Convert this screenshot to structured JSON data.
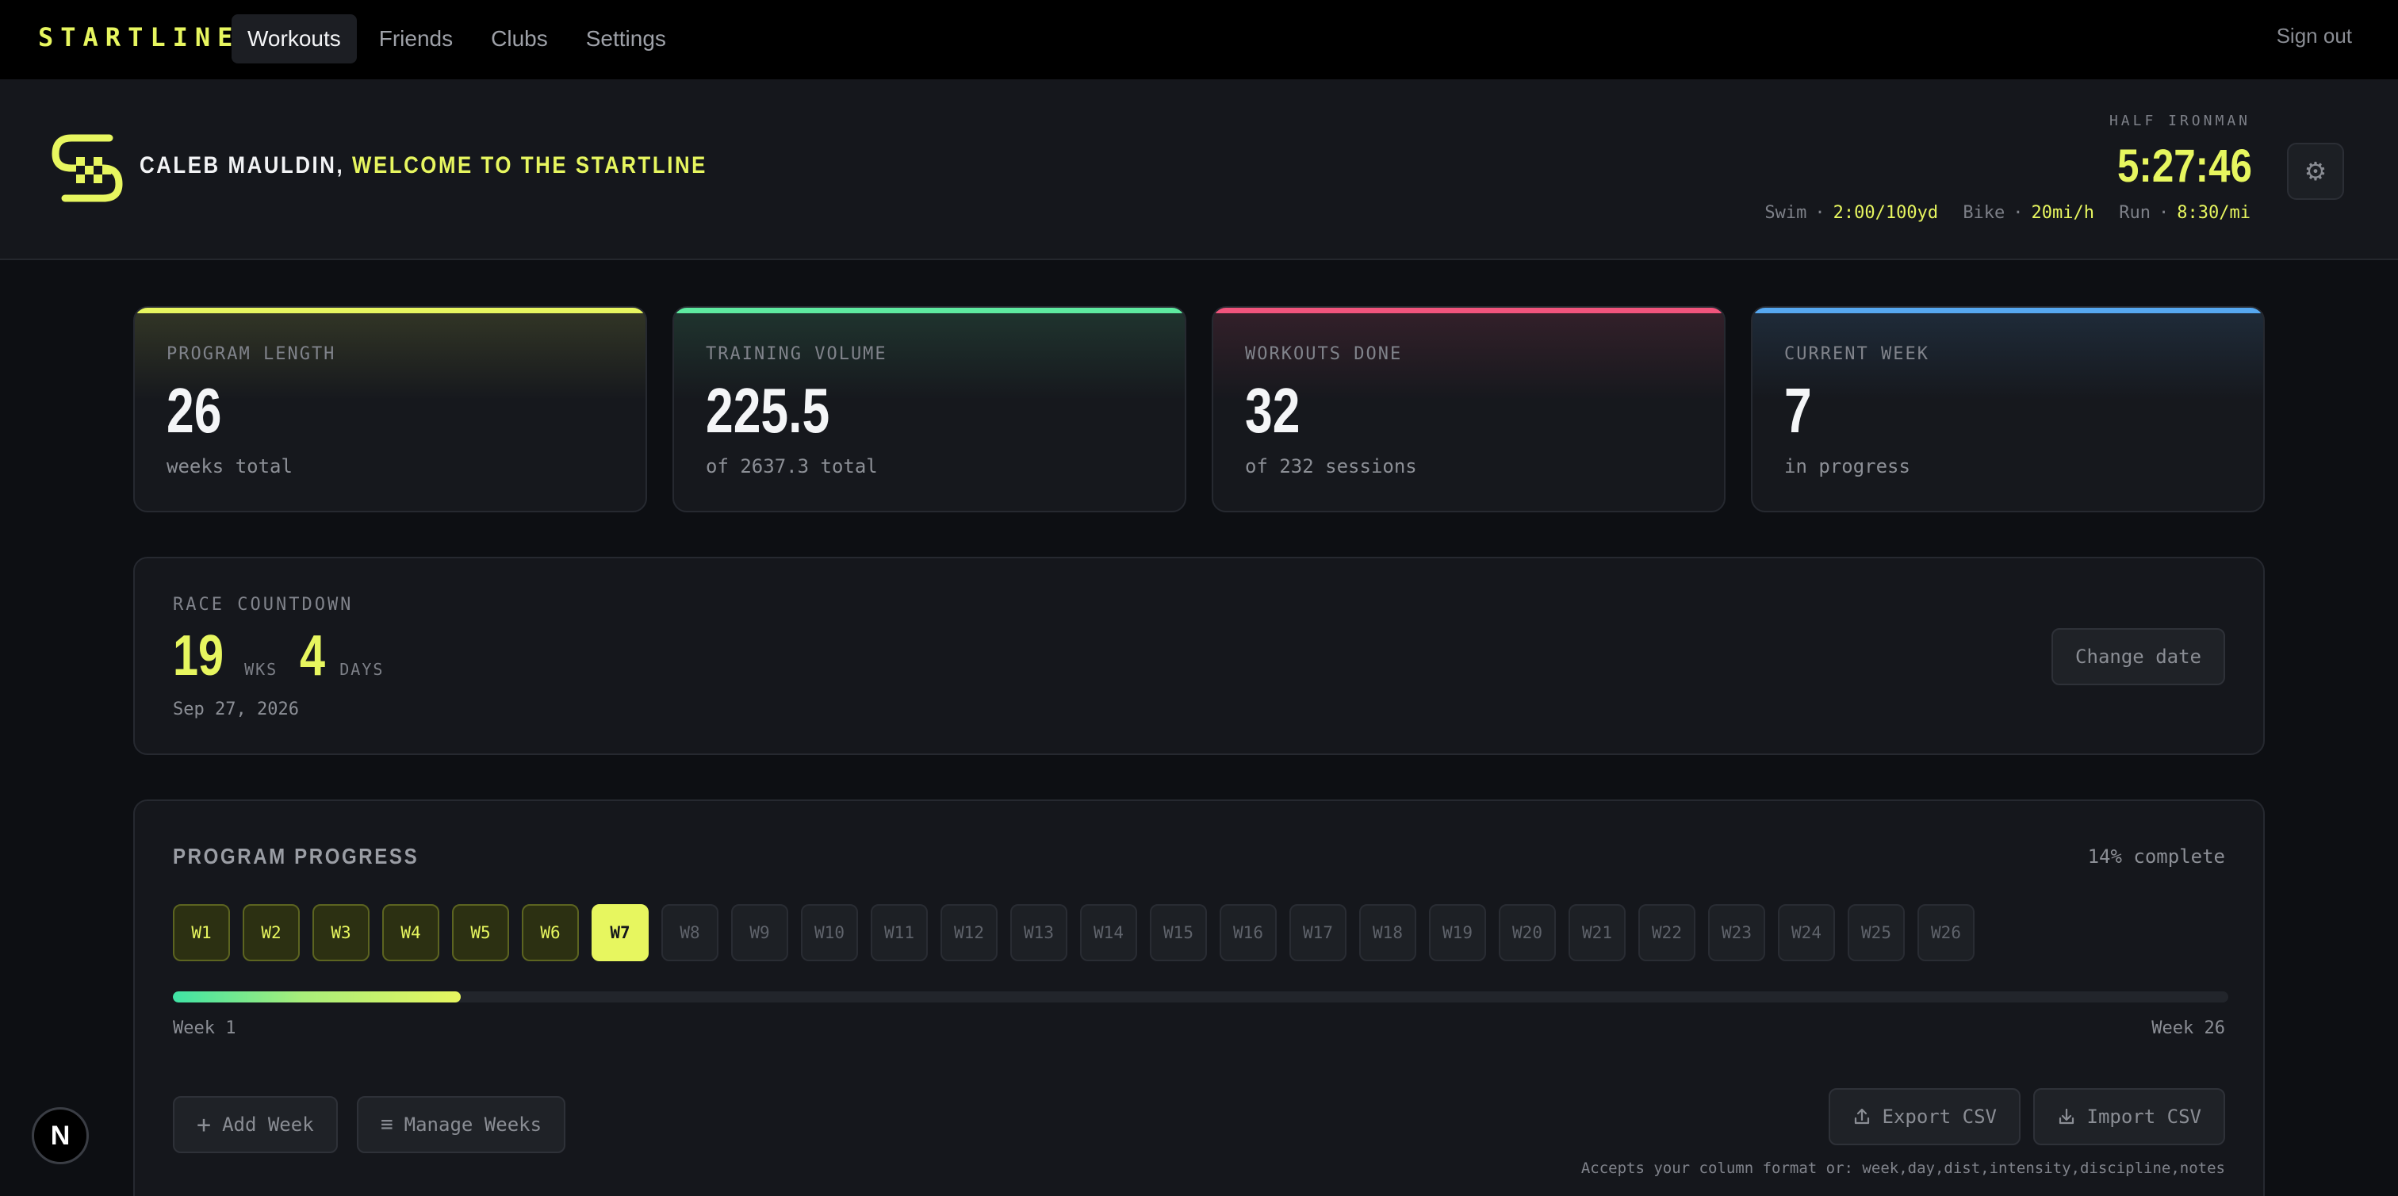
{
  "brand": {
    "name": "STARTLINE",
    "accent": "#e7f65f"
  },
  "nav": {
    "items": [
      {
        "label": "Workouts",
        "active": true
      },
      {
        "label": "Friends",
        "active": false
      },
      {
        "label": "Clubs",
        "active": false
      },
      {
        "label": "Settings",
        "active": false
      }
    ],
    "sign_out": "Sign out"
  },
  "header": {
    "user_name": "CALEB MAULDIN,",
    "greeting": "WELCOME TO THE STARTLINE",
    "race_type": "HALF IRONMAN",
    "race_time": "5:27:46",
    "paces": {
      "swim_label": "Swim",
      "swim_value": "2:00/100yd",
      "bike_label": "Bike",
      "bike_value": "20mi/h",
      "run_label": "Run",
      "run_value": "8:30/mi",
      "separator": "·"
    },
    "settings_icon": "gear-icon"
  },
  "stats": [
    {
      "label": "PROGRAM LENGTH",
      "value": "26",
      "sub": "weeks total",
      "color": "#e7f65f"
    },
    {
      "label": "TRAINING VOLUME",
      "value": "225.5",
      "sub": "of 2637.3 total",
      "color": "#5eeaa0"
    },
    {
      "label": "WORKOUTS DONE",
      "value": "32",
      "sub": "of 232 sessions",
      "color": "#f0547c"
    },
    {
      "label": "CURRENT WEEK",
      "value": "7",
      "sub": "in progress",
      "color": "#56a8f0"
    }
  ],
  "countdown": {
    "label": "RACE COUNTDOWN",
    "weeks": "19",
    "weeks_unit": "WKS",
    "days": "4",
    "days_unit": "DAYS",
    "date": "Sep 27, 2026",
    "change_date_label": "Change date"
  },
  "program": {
    "title": "PROGRAM PROGRESS",
    "complete_text": "14% complete",
    "progress_fraction": 0.14,
    "current_week": 7,
    "total_weeks": 26,
    "week_prefix": "W",
    "start_label": "Week 1",
    "end_label": "Week 26",
    "add_week_label": "Add Week",
    "manage_weeks_label": "Manage Weeks",
    "export_label": "Export CSV",
    "import_label": "Import CSV",
    "accepts_text": "Accepts your column format or: week,day,dist,intensity,discipline,notes"
  },
  "dev_badge": "N"
}
